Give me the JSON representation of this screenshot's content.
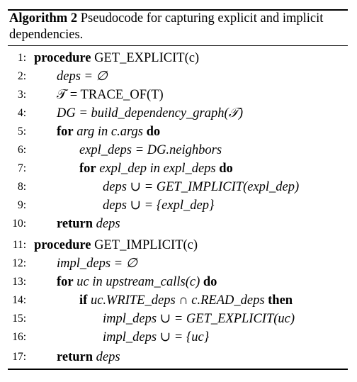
{
  "caption": {
    "label": "Algorithm 2",
    "text": "Pseudocode for capturing explicit and implicit dependencies."
  },
  "lines": [
    {
      "num": "1:",
      "kw": "procedure",
      "rest": " GET_EXPLICIT(c)"
    },
    {
      "num": "2:",
      "text": "deps = ∅"
    },
    {
      "num": "3:",
      "text": "𝒯 = TRACE_OF(T)"
    },
    {
      "num": "4:",
      "text": "DG = build_dependency_graph(𝒯)"
    },
    {
      "num": "5:",
      "kw": "for",
      "rest": " arg in c.args ",
      "kw2": "do"
    },
    {
      "num": "6:",
      "text": "expl_deps = DG.neighbors"
    },
    {
      "num": "7:",
      "kw": "for",
      "rest": " expl_dep in expl_deps ",
      "kw2": "do"
    },
    {
      "num": "8:",
      "text": "deps ∪ = GET_IMPLICIT(expl_dep)"
    },
    {
      "num": "9:",
      "text": "deps ∪ = {expl_dep}"
    },
    {
      "num": "10:",
      "kw": "return",
      "rest": " deps"
    },
    {
      "num": "11:",
      "kw": "procedure",
      "rest": " GET_IMPLICIT(c)"
    },
    {
      "num": "12:",
      "text": "impl_deps = ∅"
    },
    {
      "num": "13:",
      "kw": "for",
      "rest": " uc in upstream_calls(c) ",
      "kw2": "do"
    },
    {
      "num": "14:",
      "kw": "if",
      "rest": " uc.WRITE_deps ∩ c.READ_deps ",
      "kw2": "then"
    },
    {
      "num": "15:",
      "text": "impl_deps ∪ = GET_EXPLICIT(uc)"
    },
    {
      "num": "16:",
      "text": "impl_deps ∪ = {uc}"
    },
    {
      "num": "17:",
      "kw": "return",
      "rest": " deps"
    }
  ]
}
